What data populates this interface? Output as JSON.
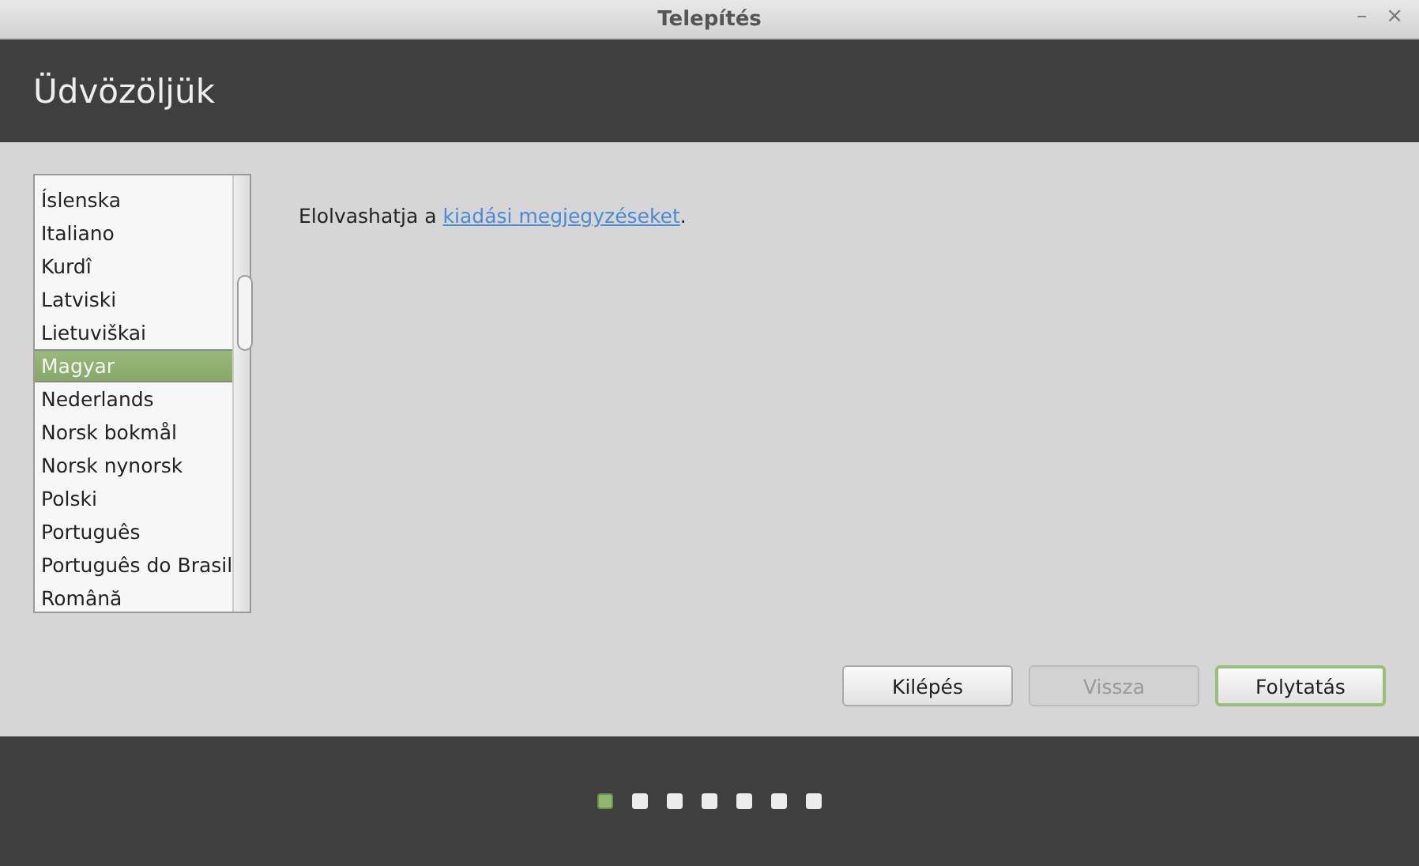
{
  "window": {
    "title": "Telepítés",
    "controls": [
      "–",
      "×"
    ]
  },
  "header": {
    "title": "Üdvözöljük"
  },
  "languages": [
    {
      "label": "Íslenska",
      "selected": false
    },
    {
      "label": "Italiano",
      "selected": false
    },
    {
      "label": "Kurdî",
      "selected": false
    },
    {
      "label": "Latviski",
      "selected": false
    },
    {
      "label": "Lietuviškai",
      "selected": false
    },
    {
      "label": "Magyar",
      "selected": true
    },
    {
      "label": "Nederlands",
      "selected": false
    },
    {
      "label": "Norsk bokmål",
      "selected": false
    },
    {
      "label": "Norsk nynorsk",
      "selected": false
    },
    {
      "label": "Polski",
      "selected": false
    },
    {
      "label": "Português",
      "selected": false
    },
    {
      "label": "Português do Brasil",
      "selected": false
    },
    {
      "label": "Română",
      "selected": false
    }
  ],
  "notes": {
    "text": "Elolvashatja a ",
    "link": "kiadási megjegyzéseket",
    "after": "."
  },
  "buttons": [
    {
      "label": "Kilépés",
      "disabled": false,
      "default": false
    },
    {
      "label": "Vissza",
      "disabled": true,
      "default": false
    },
    {
      "label": "Folytatás",
      "disabled": false,
      "default": true
    }
  ],
  "steps": [
    {
      "selected": true
    },
    {
      "selected": false
    },
    {
      "selected": false
    },
    {
      "selected": false
    },
    {
      "selected": false
    },
    {
      "selected": false
    },
    {
      "selected": false
    }
  ]
}
